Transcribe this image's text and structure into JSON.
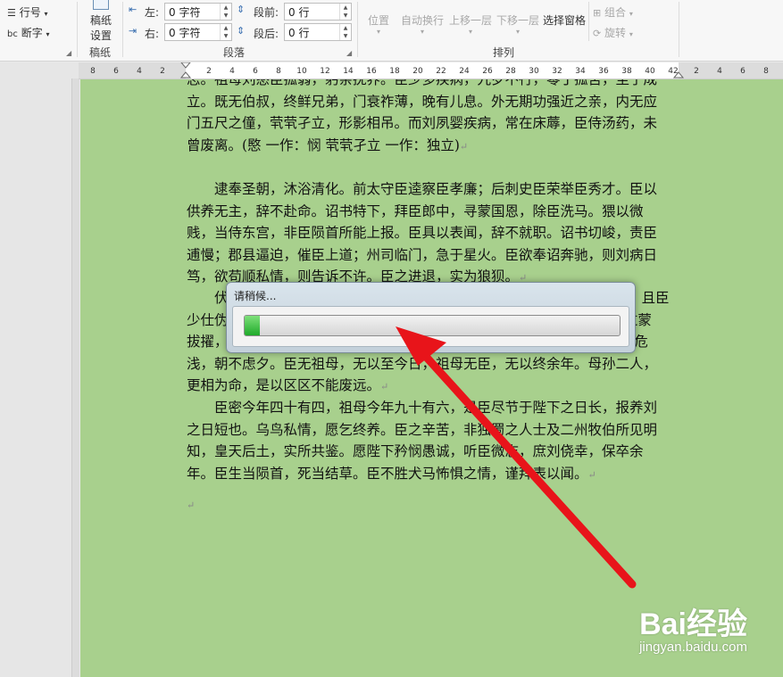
{
  "ribbon": {
    "line_numbers": "行号",
    "hyphenation": "断字",
    "manuscript_btn_line1": "稿纸",
    "manuscript_btn_line2": "设置",
    "group_manuscript": "稿纸",
    "indent_left_label": "左:",
    "indent_left_value": "0 字符",
    "indent_right_label": "右:",
    "indent_right_value": "0 字符",
    "space_before_label": "段前:",
    "space_before_value": "0 行",
    "space_after_label": "段后:",
    "space_after_value": "0 行",
    "group_paragraph": "段落",
    "position": "位置",
    "wrap_text": "自动换行",
    "bring_forward": "上移一层",
    "send_backward": "下移一层",
    "selection_pane": "选择窗格",
    "group": "组合",
    "rotate": "旋转",
    "group_arrange": "排列"
  },
  "ruler": {
    "left_ticks": [
      "8",
      "6",
      "4",
      "2"
    ],
    "right_ticks": [
      "2",
      "4",
      "6",
      "8",
      "10",
      "12",
      "14",
      "16",
      "18",
      "20",
      "22",
      "24",
      "26",
      "28",
      "30",
      "32",
      "34",
      "36",
      "38",
      "40",
      "42"
    ],
    "after_ticks": [
      "2",
      "4",
      "6",
      "8"
    ]
  },
  "document": {
    "para1_lines": [
      "志。祖母刘愍臣孤弱，躬亲抚养。臣少多疾病，九岁不行，零丁孤苦，至于成",
      "立。既无伯叔，终鲜兄弟，门衰祚薄，晚有儿息。外无期功强近之亲，内无应",
      "门五尺之僮，茕茕孑立，形影相吊。而刘夙婴疾病，常在床蓐，臣侍汤药，未",
      "曾废离。(愍 一作：悯 茕茕孑立 一作：独立)"
    ],
    "para2_lines": [
      "逮奉圣朝，沐浴清化。前太守臣逵察臣孝廉；后刺史臣荣举臣秀才。臣以",
      "供养无主，辞不赴命。诏书特下，拜臣郎中，寻蒙国恩，除臣洗马。猥以微",
      "贱，当侍东宫，非臣陨首所能上报。臣具以表闻，辞不就职。诏书切峻，责臣",
      "逋慢；郡县逼迫，催臣上道；州司临门，急于星火。臣欲奉诏奔驰，则刘病日",
      "笃，欲苟顺私情，则告诉不许。臣之进退，实为狼狈。"
    ],
    "para3_lines": [
      "伏                                                                                              且臣",
      "少仕伪                                                                                          过蒙",
      "拔擢，                                                                                      人命危",
      "浅，朝不虑夕。臣无祖母，无以至今日，祖母无臣，无以终余年。母孙二人，",
      "更相为命，是以区区不能废远。"
    ],
    "para4_lines": [
      "臣密今年四十有四，祖母今年九十有六，是臣尽节于陛下之日长，报养刘",
      "之日短也。乌鸟私情，愿乞终养。臣之辛苦，非独蜀之人士及二州牧伯所见明",
      "知，皇天后土，实所共鉴。愿陛下矜悯愚诚，听臣微志，庶刘侥幸，保卒余",
      "年。臣生当陨首，死当结草。臣不胜犬马怖惧之情，谨拜表以闻。"
    ],
    "paragraph_mark": "↵"
  },
  "dialog": {
    "title": "请稍候...",
    "progress_fraction": 0.04
  },
  "watermark": {
    "logo": "Bai经验",
    "url": "jingyan.baidu.com"
  },
  "colors": {
    "page_background": "#a8d08d",
    "arrow": "#e8141a",
    "progress": "#22b02c"
  }
}
